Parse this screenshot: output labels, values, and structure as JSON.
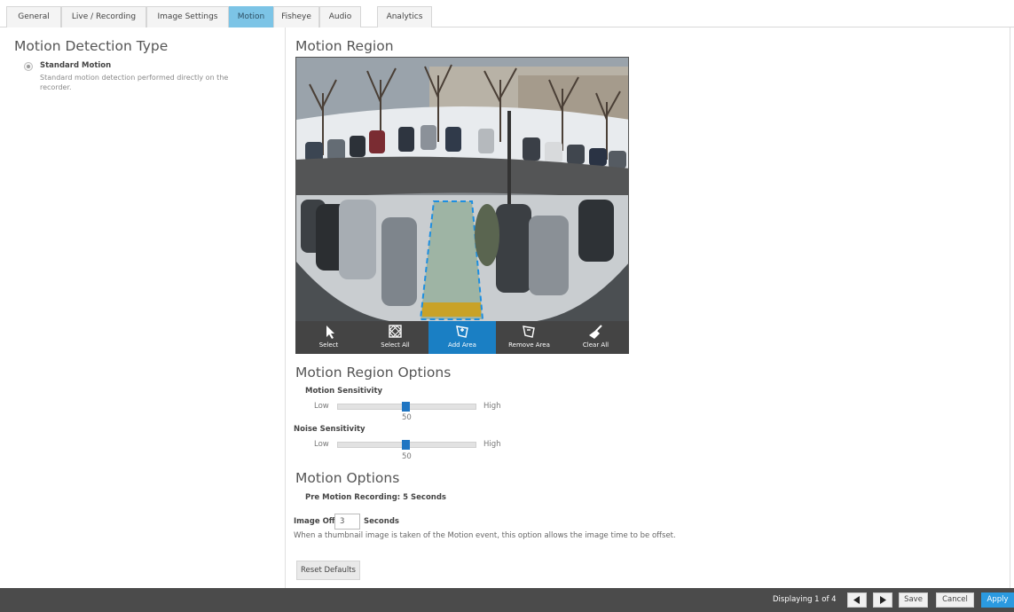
{
  "tabs": [
    {
      "label": "General"
    },
    {
      "label": "Live / Recording"
    },
    {
      "label": "Image Settings"
    },
    {
      "label": "Motion",
      "active": true
    },
    {
      "label": "Fisheye"
    },
    {
      "label": "Audio"
    },
    {
      "label": "Analytics"
    }
  ],
  "left": {
    "title": "Motion Detection Type",
    "option_title": "Standard Motion",
    "option_desc": "Standard motion detection performed directly on the recorder.",
    "option_selected": true
  },
  "region": {
    "title": "Motion Region",
    "tools": [
      {
        "label": "Select",
        "icon": "cursor-icon"
      },
      {
        "label": "Select All",
        "icon": "select-all-icon"
      },
      {
        "label": "Add Area",
        "icon": "add-area-icon",
        "active": true
      },
      {
        "label": "Remove Area",
        "icon": "remove-area-icon"
      },
      {
        "label": "Clear All",
        "icon": "broom-icon"
      }
    ]
  },
  "region_options": {
    "title": "Motion Region Options",
    "motion_label": "Motion Sensitivity",
    "motion_low": "Low",
    "motion_high": "High",
    "motion_value": "50",
    "noise_label": "Noise Sensitivity",
    "noise_low": "Low",
    "noise_high": "High",
    "noise_value": "50"
  },
  "motion_options": {
    "title": "Motion Options",
    "pre_motion": "Pre Motion Recording: 5 Seconds",
    "offset_label": "Image Offset",
    "offset_value": "3",
    "offset_unit": "Seconds",
    "offset_desc": "When a thumbnail image is taken of the Motion event, this option allows the image time to be offset.",
    "reset_label": "Reset Defaults"
  },
  "footer": {
    "displaying": "Displaying 1 of 4",
    "save": "Save",
    "cancel": "Cancel",
    "apply": "Apply"
  },
  "colors": {
    "active_tab": "#7cc4e6",
    "accent_blue": "#1a7fc4",
    "footer_bg": "#4b4b4b",
    "apply_btn": "#2b9ae0"
  }
}
